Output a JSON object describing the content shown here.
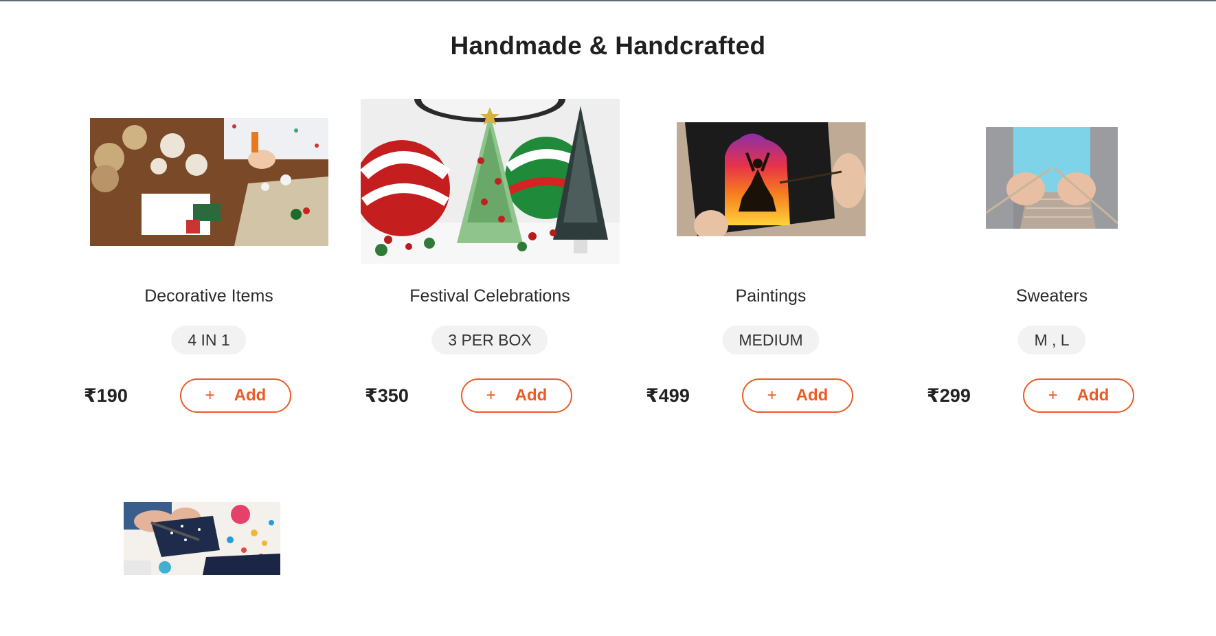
{
  "section": {
    "title": "Handmade & Handcrafted"
  },
  "products": [
    {
      "name": "Decorative Items",
      "variant": "4 IN 1",
      "price": "₹190",
      "add_label": "Add",
      "image": "decorative-items-photo"
    },
    {
      "name": "Festival Celebrations",
      "variant": "3 PER BOX",
      "price": "₹350",
      "add_label": "Add",
      "image": "festival-celebrations-photo"
    },
    {
      "name": "Paintings",
      "variant": "MEDIUM",
      "price": "₹499",
      "add_label": "Add",
      "image": "paintings-photo"
    },
    {
      "name": "Sweaters",
      "variant": "M , L",
      "price": "₹299",
      "add_label": "Add",
      "image": "sweaters-photo"
    }
  ],
  "extra_product": {
    "image": "sewing-crafts-photo"
  },
  "colors": {
    "accent": "#ea5b25",
    "pill_bg": "#f2f2f2",
    "top_border": "#5e6b7a"
  },
  "icons": {
    "add": "plus-icon"
  }
}
